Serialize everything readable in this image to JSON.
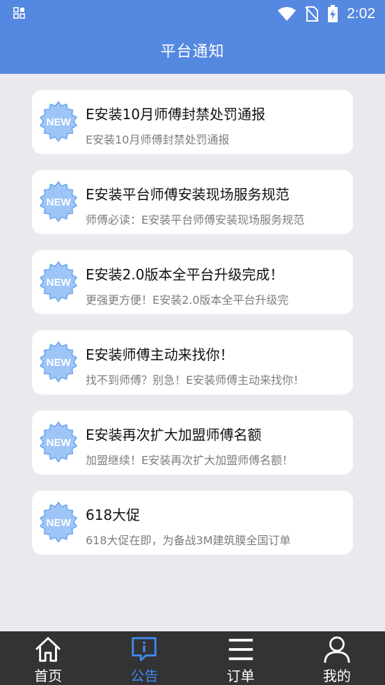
{
  "status_bar": {
    "time": "2:02",
    "icons": [
      "notification-grid-icon",
      "wifi-icon",
      "no-sim-icon",
      "battery-charging-icon"
    ]
  },
  "header": {
    "title": "平台通知"
  },
  "badge_text": "NEW",
  "notices": [
    {
      "title": "E安装10月师傅封禁处罚通报",
      "summary": "E安装10月师傅封禁处罚通报"
    },
    {
      "title": "E安装平台师傅安装现场服务规范",
      "summary": "师傅必读：E安装平台师傅安装现场服务规范"
    },
    {
      "title": "E安装2.0版本全平台升级完成！",
      "summary": "更强更方便！E安装2.0版本全平台升级完"
    },
    {
      "title": "E安装师傅主动来找你！",
      "summary": "找不到师傅？别急！E安装师傅主动来找你！"
    },
    {
      "title": "E安装再次扩大加盟师傅名额",
      "summary": "加盟继续！E安装再次扩大加盟师傅名额！"
    },
    {
      "title": "618大促",
      "summary": "618大促在即，为备战3M建筑膜全国订单"
    }
  ],
  "tabs": [
    {
      "label": "首页",
      "icon": "home-icon"
    },
    {
      "label": "公告",
      "icon": "announcement-icon",
      "active": true
    },
    {
      "label": "订单",
      "icon": "menu-list-icon"
    },
    {
      "label": "我的",
      "icon": "user-icon"
    }
  ],
  "colors": {
    "header": "#5588e0",
    "background": "#e9eaee",
    "badge": "#9ec5f7",
    "tabbar": "#333333",
    "tab_active": "#3d8bf0"
  }
}
